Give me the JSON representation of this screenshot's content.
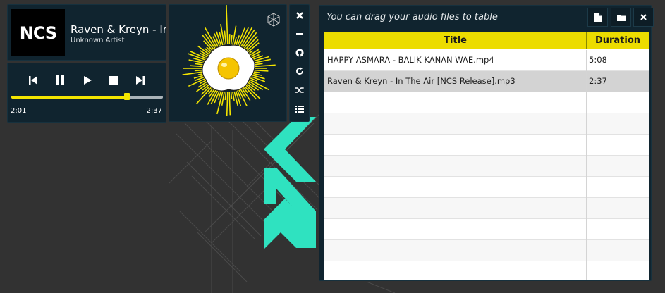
{
  "now_playing": {
    "art_text": "NCS",
    "title": "Raven & Kreyn - In The Air [NCS Release]",
    "artist": "Unknown Artist"
  },
  "controls": {
    "icons": [
      "previous-icon",
      "pause-icon",
      "play-icon",
      "stop-icon",
      "next-icon"
    ],
    "progress": 0.764,
    "current_time": "2:01",
    "total_time": "2:37"
  },
  "visualizer": {
    "icon": "hexagon-logo-icon",
    "accent_color": "#f4e500"
  },
  "side_toolbar": {
    "icons": [
      "close-icon",
      "minimize-icon",
      "github-icon",
      "repeat-icon",
      "shuffle-icon",
      "playlist-icon"
    ]
  },
  "playlist": {
    "hint": "You can drag your audio files to table",
    "buttons": [
      "add-file-icon",
      "add-folder-icon",
      "clear-icon"
    ],
    "columns": [
      "Title",
      "Duration"
    ],
    "rows": [
      {
        "title": "HAPPY ASMARA - BALIK KANAN WAE.mp4",
        "duration": "5:08"
      },
      {
        "title": "Raven & Kreyn - In The Air [NCS Release].mp3",
        "duration": "2:37"
      }
    ],
    "selected_index": 1,
    "header_color": "#ecdc00"
  },
  "colors": {
    "panel": "#10242f",
    "background": "#323232",
    "logo_teal": "#2fe2c0"
  }
}
